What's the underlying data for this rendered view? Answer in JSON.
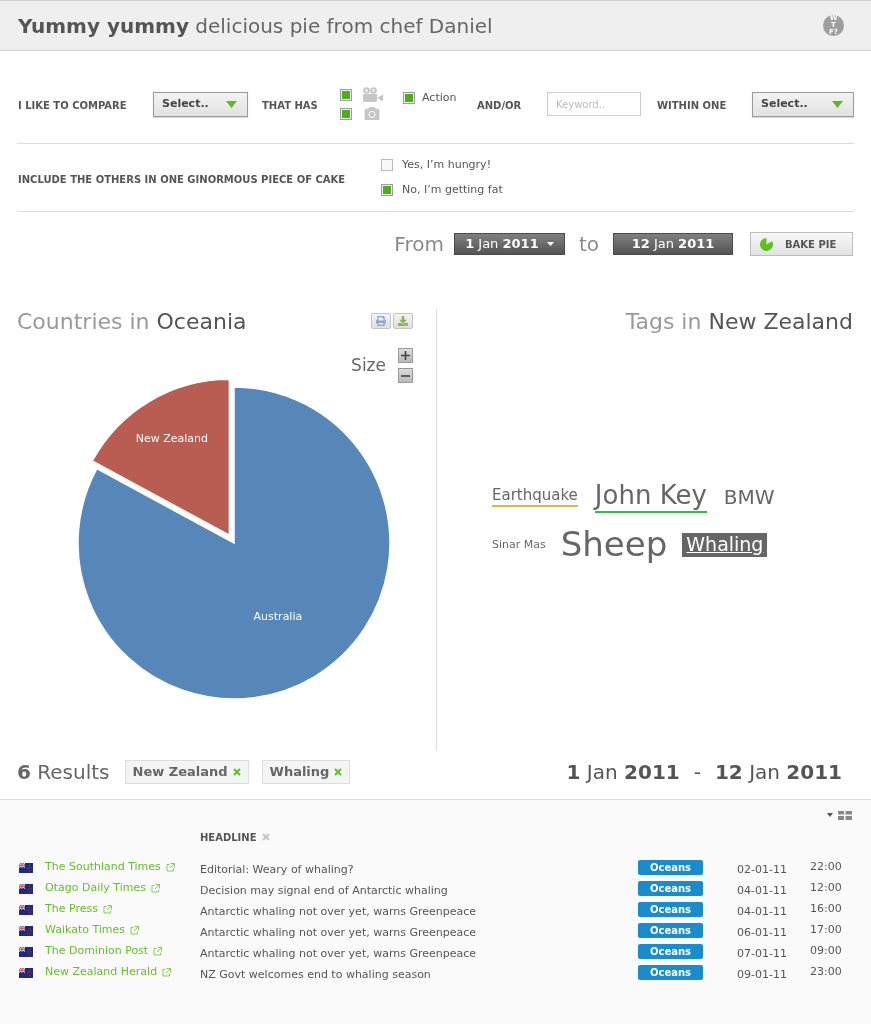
{
  "header": {
    "title": "**Yummy yummy** delicious pie from chef Daniel",
    "help_badge": "WTF?"
  },
  "filters": {
    "compare": {
      "label": "I LIKE TO COMPARE",
      "select": "Select.."
    },
    "that_has": {
      "label": "THAT HAS",
      "media": [
        {
          "kind": "video",
          "checked": true
        },
        {
          "kind": "photo",
          "checked": true
        }
      ],
      "action": {
        "label": "Action",
        "checked": true
      }
    },
    "and_or": {
      "label": "AND/OR",
      "placeholder": "Keyword.."
    },
    "within": {
      "label": "WITHIN ONE",
      "select": "Select.."
    },
    "include_others": {
      "label": "INCLUDE THE OTHERS IN ONE GINORMOUS PIECE OF CAKE",
      "options": [
        {
          "label": "Yes, I’m hungry!",
          "checked": false
        },
        {
          "label": "No, I’m getting fat",
          "checked": true
        }
      ]
    }
  },
  "date_range": {
    "from_label": "From",
    "from": {
      "value": "**1** Jan **2011**",
      "dropdown": true
    },
    "to_label": "to",
    "to": {
      "value": "**12** Jan **2011**",
      "dropdown": false
    },
    "button": "BAKE PIE"
  },
  "countries_panel": {
    "title_prefix": "Countries in",
    "title_region": "Oceania",
    "size_label": "Size",
    "pie": {
      "slices": [
        {
          "label": "New Zealand",
          "color": "#b95c52",
          "exploded": true
        },
        {
          "label": "Australia",
          "color": "#5687b8",
          "exploded": false
        }
      ]
    }
  },
  "tags_panel": {
    "title_prefix": "Tags in",
    "title_region": "New Zealand",
    "rows": [
      {
        "tags": [
          {
            "label": "Earthquake",
            "color": "#d1c03c",
            "selected": false
          },
          {
            "label": "John Key",
            "color": "#35bb45",
            "selected": false
          },
          {
            "label": "BMW",
            "selected": false
          }
        ]
      },
      {
        "tags": [
          {
            "label": "Sinar Mas",
            "selected": false
          },
          {
            "label": "Sheep",
            "selected": false
          },
          {
            "label": "Whaling",
            "selected": true
          }
        ]
      }
    ]
  },
  "results": {
    "count": "**6** Results",
    "filters": [
      {
        "label": "New Zealand"
      },
      {
        "label": "Whaling"
      }
    ],
    "range_from": "**1** Jan **2011**",
    "range_separator": "-",
    "range_to": "**12** Jan **2011**"
  },
  "table": {
    "columns": [
      {
        "label": "HEADLINE"
      }
    ],
    "rows": [
      {
        "source": "The Southland Times",
        "headline": "Editorial: Weary of whaling?",
        "category": "Oceans",
        "date": "02-01-11",
        "time": "22:00"
      },
      {
        "source": "Otago Daily Times",
        "headline": "Decision may signal end of Antarctic whaling",
        "category": "Oceans",
        "date": "04-01-11",
        "time": "12:00"
      },
      {
        "source": "The Press",
        "headline": "Antarctic whaling not over yet, warns Greenpeace",
        "category": "Oceans",
        "date": "04-01-11",
        "time": "16:00"
      },
      {
        "source": "Waikato Times",
        "headline": "Antarctic whaling not over yet, warns Greenpeace",
        "category": "Oceans",
        "date": "06-01-11",
        "time": "17:00"
      },
      {
        "source": "The Dominion Post",
        "headline": "Antarctic whaling not over yet, warns Greenpeace",
        "category": "Oceans",
        "date": "07-01-11",
        "time": "09:00"
      },
      {
        "source": "New Zealand Herald",
        "headline": "NZ Govt welcomes end to whaling season",
        "category": "Oceans",
        "date": "09-01-11",
        "time": "23:00"
      }
    ]
  }
}
